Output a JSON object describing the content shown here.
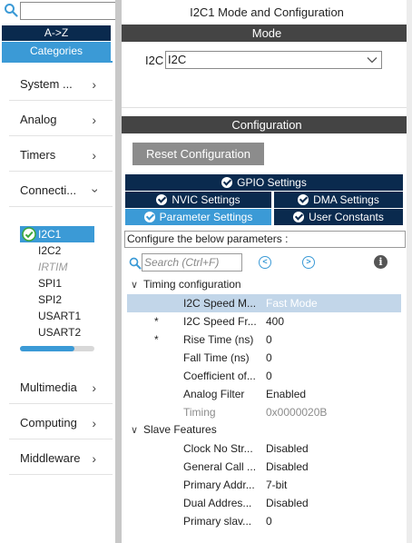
{
  "left_panel": {
    "search": {
      "value": "",
      "placeholder": ""
    },
    "az_button": "A->Z",
    "categories_tab": "Categories",
    "categories": [
      {
        "label": "System ...",
        "expanded": false
      },
      {
        "label": "Analog",
        "expanded": false
      },
      {
        "label": "Timers",
        "expanded": false
      },
      {
        "label": "Connecti...",
        "expanded": true
      },
      {
        "label": "Multimedia",
        "expanded": false
      },
      {
        "label": "Computing",
        "expanded": false
      },
      {
        "label": "Middleware",
        "expanded": false
      }
    ],
    "peripherals": [
      {
        "label": "I2C1",
        "state": "selected-enabled"
      },
      {
        "label": "I2C2",
        "state": "normal"
      },
      {
        "label": "IRTIM",
        "state": "disabled"
      },
      {
        "label": "SPI1",
        "state": "normal"
      },
      {
        "label": "SPI2",
        "state": "normal"
      },
      {
        "label": "USART1",
        "state": "normal"
      },
      {
        "label": "USART2",
        "state": "normal"
      }
    ]
  },
  "right_panel": {
    "title": "I2C1 Mode and Configuration",
    "mode_header": "Mode",
    "mode_field_label": "I2C",
    "mode_field_value": "I2C",
    "config_header": "Configuration",
    "reset_button": "Reset Configuration",
    "tabs": {
      "gpio": "GPIO Settings",
      "nvic": "NVIC Settings",
      "dma": "DMA Settings",
      "params": "Parameter Settings",
      "user_constants": "User Constants"
    },
    "active_tab": "params",
    "hint": "Configure the below parameters :",
    "param_search": {
      "value": "",
      "placeholder": "Search (Ctrl+F)"
    },
    "groups": [
      {
        "label": "Timing configuration",
        "params": [
          {
            "star": "",
            "name": "I2C Speed M...",
            "value": "Fast Mode",
            "highlight": true,
            "dim": false
          },
          {
            "star": "*",
            "name": "I2C Speed Fr...",
            "value": "400",
            "highlight": false,
            "dim": false
          },
          {
            "star": "*",
            "name": "Rise Time (ns)",
            "value": "0",
            "highlight": false,
            "dim": false
          },
          {
            "star": "",
            "name": "Fall Time (ns)",
            "value": "0",
            "highlight": false,
            "dim": false
          },
          {
            "star": "",
            "name": "Coefficient of...",
            "value": "0",
            "highlight": false,
            "dim": false
          },
          {
            "star": "",
            "name": "Analog Filter",
            "value": "Enabled",
            "highlight": false,
            "dim": false
          },
          {
            "star": "",
            "name": "Timing",
            "value": "0x0000020B",
            "highlight": false,
            "dim": true
          }
        ]
      },
      {
        "label": "Slave Features",
        "params": [
          {
            "star": "",
            "name": "Clock No Str...",
            "value": "Disabled",
            "highlight": false,
            "dim": false
          },
          {
            "star": "",
            "name": "General Call ...",
            "value": "Disabled",
            "highlight": false,
            "dim": false
          },
          {
            "star": "",
            "name": "Primary Addr...",
            "value": "7-bit",
            "highlight": false,
            "dim": false
          },
          {
            "star": "",
            "name": "Dual Addres...",
            "value": "Disabled",
            "highlight": false,
            "dim": false
          },
          {
            "star": "",
            "name": "Primary slav...",
            "value": "0",
            "highlight": false,
            "dim": false
          }
        ]
      }
    ]
  },
  "colors": {
    "navy": "#0a2a4e",
    "accent_blue": "#3b9ad6",
    "section_bar": "#444444",
    "highlight_row": "#c2d6e9",
    "enabled_green": "#3aa63a"
  },
  "icons": {
    "search": "search-icon",
    "chevron_right": "chevron-right-icon",
    "chevron_down": "chevron-down-icon",
    "check": "check-circle-icon",
    "prev": "arrow-left-circle-icon",
    "next": "arrow-right-circle-icon",
    "info": "info-icon"
  }
}
